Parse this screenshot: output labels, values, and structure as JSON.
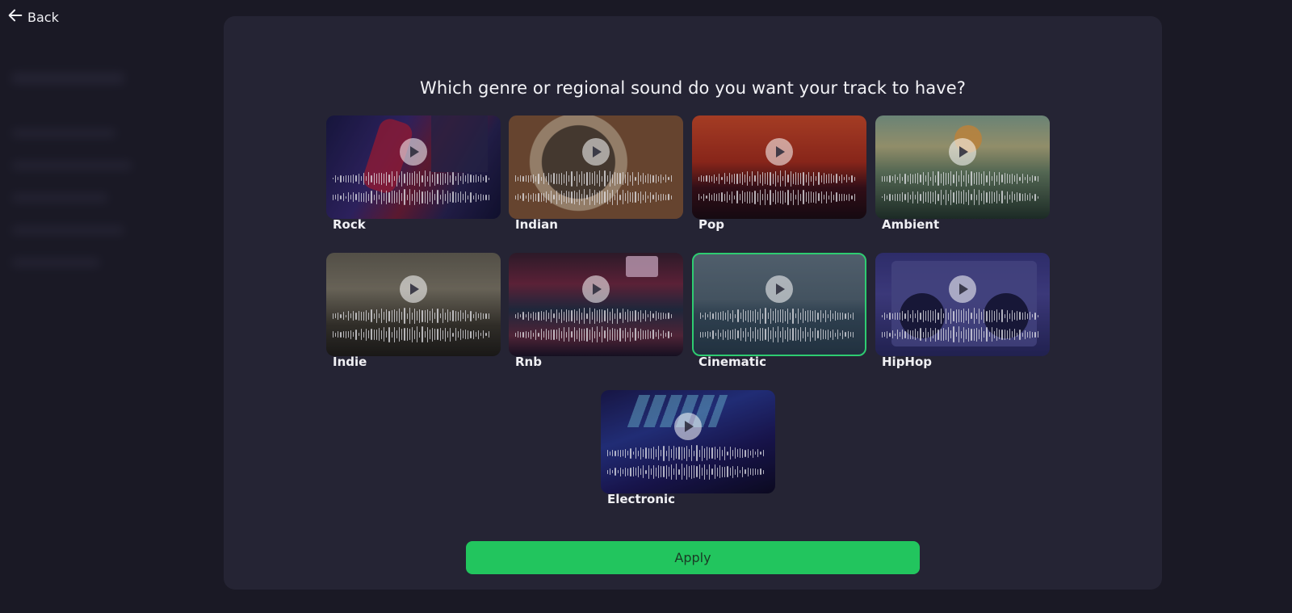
{
  "nav": {
    "back_label": "Back"
  },
  "dialog": {
    "question": "Which genre or regional sound do you want your track to have?",
    "apply_label": "Apply"
  },
  "genres": [
    {
      "label": "Rock",
      "selected": false
    },
    {
      "label": "Indian",
      "selected": false
    },
    {
      "label": "Pop",
      "selected": false
    },
    {
      "label": "Ambient",
      "selected": false
    },
    {
      "label": "Indie",
      "selected": false
    },
    {
      "label": "Rnb",
      "selected": false
    },
    {
      "label": "Cinematic",
      "selected": true
    },
    {
      "label": "HipHop",
      "selected": false
    },
    {
      "label": "Electronic",
      "selected": false
    }
  ],
  "colors": {
    "accent": "#22c55e",
    "selected_border": "#2ecc71",
    "modal_bg": "#252434",
    "page_bg": "#1a1925"
  }
}
